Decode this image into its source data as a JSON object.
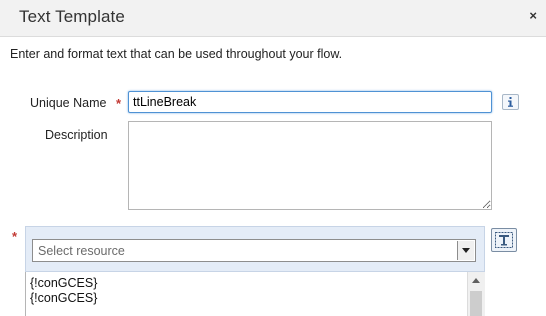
{
  "dialog": {
    "title": "Text Template",
    "close_label": "×"
  },
  "intro_text": "Enter and format text that can be used throughout your flow.",
  "fields": {
    "unique_name": {
      "label": "Unique Name",
      "required_mark": "*",
      "value": "ttLineBreak"
    },
    "description": {
      "label": "Description",
      "value": ""
    }
  },
  "resource": {
    "required_mark": "*",
    "placeholder": "Select resource"
  },
  "editor": {
    "lines": [
      "{!conGCES}",
      "{!conGCES}"
    ]
  },
  "icons": {
    "info": "info-icon",
    "dropdown": "chevron-down-icon",
    "format": "text-format-icon",
    "scroll_up": "arrow-up-icon"
  },
  "colors": {
    "required": "#c23934",
    "focus_border": "#4f92d4",
    "resource_panel": "#e4ecf7",
    "header_bg": "#f2f2f2"
  }
}
